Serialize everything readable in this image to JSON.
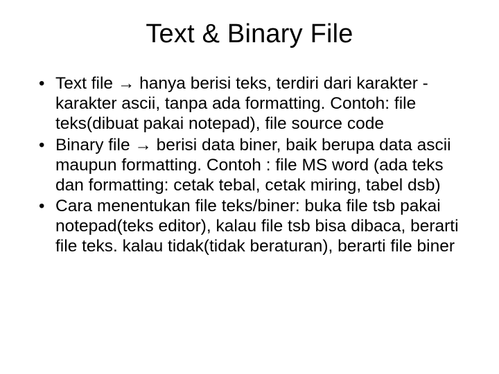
{
  "title": "Text & Binary File",
  "bullets": [
    "Text file → hanya berisi teks, terdiri dari karakter -karakter ascii, tanpa ada formatting. Contoh: file teks(dibuat pakai notepad), file source code",
    "Binary file → berisi data biner, baik berupa data ascii maupun formatting. Contoh : file MS word (ada teks dan formatting: cetak tebal, cetak miring, tabel dsb)",
    "Cara menentukan file teks/biner: buka file tsb pakai notepad(teks editor), kalau file tsb bisa dibaca, berarti file teks. kalau tidak(tidak beraturan), berarti file biner"
  ]
}
